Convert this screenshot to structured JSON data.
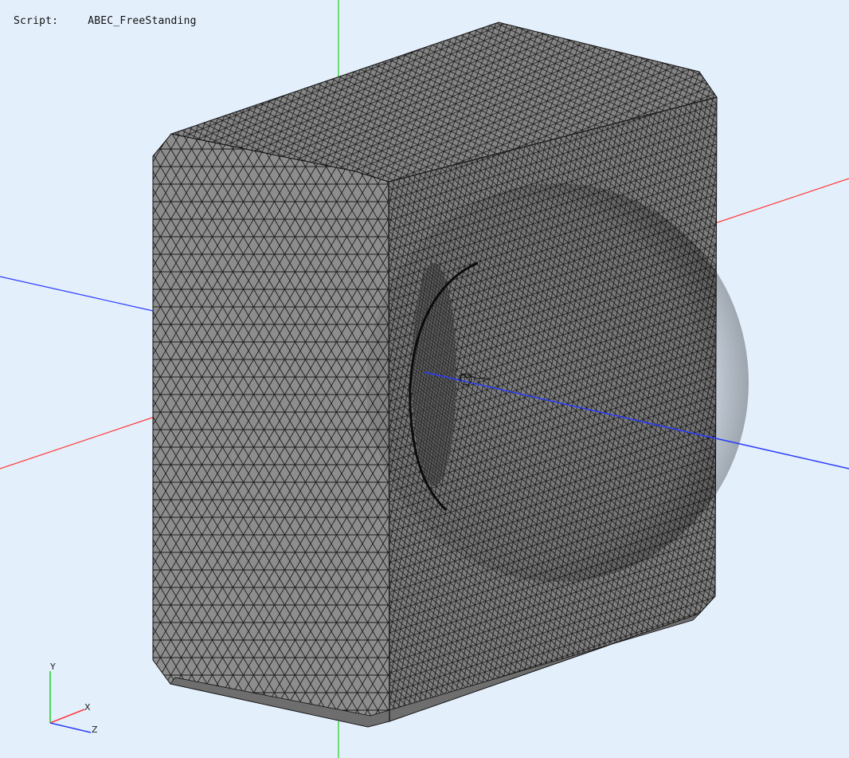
{
  "header": {
    "script_label": "Script:",
    "script_name": "ABEC_FreeStanding"
  },
  "axes_triad": {
    "x_label": "X",
    "y_label": "Y",
    "z_label": "Z"
  },
  "colors": {
    "background": "#e4effc",
    "x_axis": "#ff3a3a",
    "y_axis": "#1fce1f",
    "z_axis": "#2a3cff",
    "mesh_fill": "#8a8a8a",
    "mesh_lines": "#1a1a1a"
  },
  "icons": {
    "origin_marker": "origin-marker-icon"
  }
}
